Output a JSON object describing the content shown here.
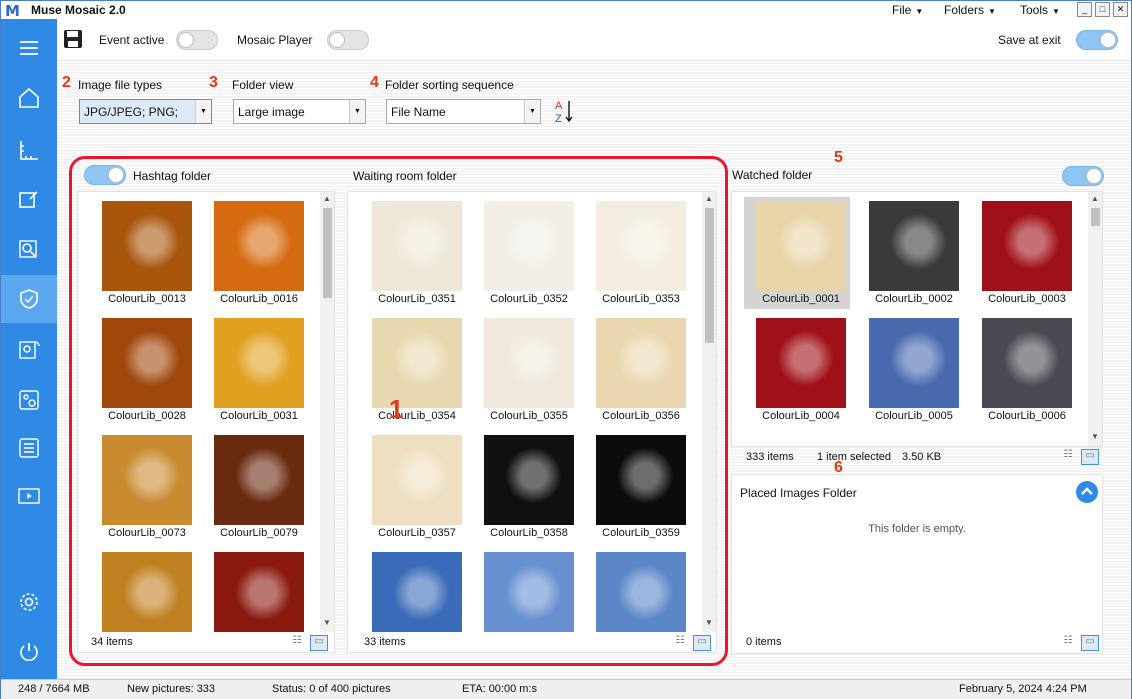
{
  "window": {
    "logo": "M",
    "title": "Muse Mosaic 2.0",
    "menus": [
      "File",
      "Folders",
      "Tools"
    ],
    "controls": [
      "_",
      "□",
      "✕"
    ]
  },
  "toolbar": {
    "event_active": "Event active",
    "mosaic_player": "Mosaic Player",
    "save_at_exit": "Save at exit"
  },
  "settings": {
    "file_types_num": "2",
    "file_types_label": "Image file types",
    "file_types_value": "JPG/JPEG; PNG;",
    "folder_view_num": "3",
    "folder_view_label": "Folder view",
    "folder_view_value": "Large image",
    "sort_num": "4",
    "sort_label": "Folder sorting sequence",
    "sort_value": "File Name"
  },
  "hashtag": {
    "title": "Hashtag folder",
    "count": "34 items",
    "items": [
      "ColourLib_0013",
      "ColourLib_0016",
      "ColourLib_0028",
      "ColourLib_0031",
      "ColourLib_0073",
      "ColourLib_0079",
      "",
      ""
    ]
  },
  "waiting": {
    "title": "Waiting room folder",
    "count": "33 items",
    "items": [
      "ColourLib_0351",
      "ColourLib_0352",
      "ColourLib_0353",
      "ColourLib_0354",
      "ColourLib_0355",
      "ColourLib_0356",
      "ColourLib_0357",
      "ColourLib_0358",
      "ColourLib_0359",
      "",
      "",
      ""
    ]
  },
  "watched": {
    "num": "5",
    "title": "Watched folder",
    "count": "333 items",
    "selected": "1 item selected",
    "size": "3.50 KB",
    "items": [
      "ColourLib_0001",
      "ColourLib_0002",
      "ColourLib_0003",
      "ColourLib_0004",
      "ColourLib_0005",
      "ColourLib_0006"
    ]
  },
  "placed": {
    "num": "6",
    "title": "Placed Images Folder",
    "empty": "This folder is empty.",
    "count": "0 items"
  },
  "annotation_1": "1",
  "statusbar": {
    "memory": "248 / 7664 MB",
    "new_pictures": "New pictures: 333",
    "status": "Status: 0 of 400 pictures",
    "eta": "ETA: 00:00 m:s",
    "datetime": "February 5, 2024  4:24 PM"
  },
  "colors": {
    "sidebar": "#2f8ae5",
    "annotation": "#e03a1a",
    "redbox": "#e8172b"
  }
}
